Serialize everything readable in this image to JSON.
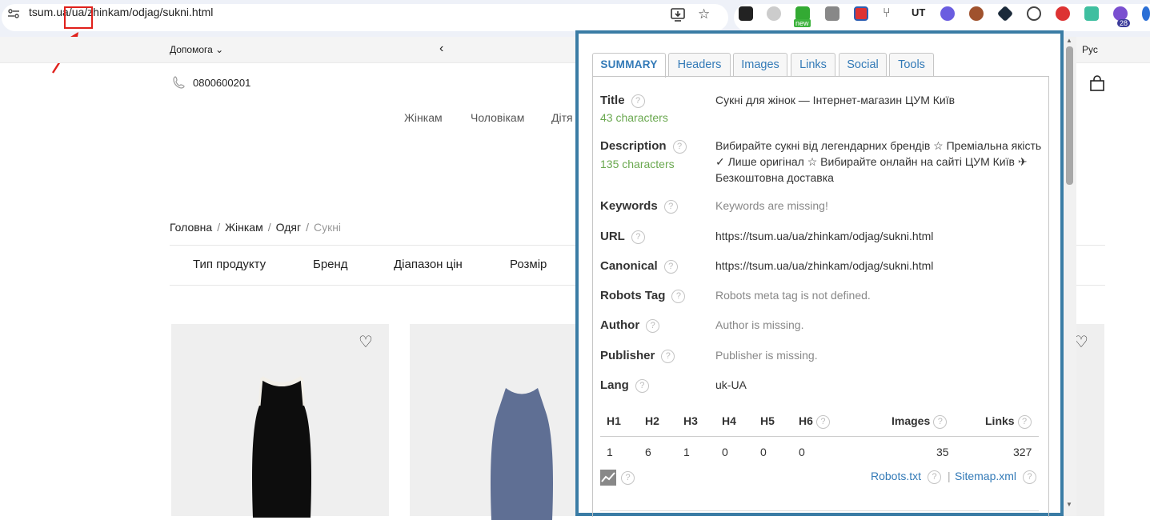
{
  "browser": {
    "url_host": "tsum.ua",
    "url_path": "/ua/zhinkam/odjag/sukni.html",
    "extension_badges": {
      "new_label": "new",
      "count_label": "28"
    }
  },
  "site": {
    "help_label": "Допомога",
    "lang_label": "Рус",
    "phone": "0800600201",
    "menu": {
      "zhinkam": "Жінкам",
      "cholovikam": "Чоловікам",
      "ditiam": "Дітя"
    },
    "breadcrumb": {
      "home": "Головна",
      "women": "Жінкам",
      "clothes": "Одяг",
      "current": "Сукні",
      "sep": "/"
    },
    "filters": {
      "type": "Тип продукту",
      "brand": "Бренд",
      "price": "Діапазон цін",
      "size": "Розмір"
    }
  },
  "seo": {
    "tabs": {
      "summary": "SUMMARY",
      "headers": "Headers",
      "images": "Images",
      "links": "Links",
      "social": "Social",
      "tools": "Tools"
    },
    "help_glyph": "?",
    "rows": {
      "title": {
        "label": "Title",
        "value": "Сукні для жінок — Інтернет-магазин ЦУМ Київ",
        "chars": "43 characters"
      },
      "description": {
        "label": "Description",
        "value": "Вибирайте сукні від легендарних брендів ☆ Преміальна якість ✓ Лише оригінал ☆ Вибирайте онлайн на сайті ЦУМ Київ ✈ Безкоштовна доставка",
        "chars": "135 characters"
      },
      "keywords": {
        "label": "Keywords",
        "value": "Keywords are missing!"
      },
      "url": {
        "label": "URL",
        "value": "https://tsum.ua/ua/zhinkam/odjag/sukni.html"
      },
      "canonical": {
        "label": "Canonical",
        "value": "https://tsum.ua/ua/zhinkam/odjag/sukni.html"
      },
      "robots": {
        "label": "Robots Tag",
        "value": "Robots meta tag is not defined."
      },
      "author": {
        "label": "Author",
        "value": "Author is missing."
      },
      "publisher": {
        "label": "Publisher",
        "value": "Publisher is missing."
      },
      "lang": {
        "label": "Lang",
        "value": "uk-UA"
      }
    },
    "stats": {
      "headers": {
        "h1": "H1",
        "h2": "H2",
        "h3": "H3",
        "h4": "H4",
        "h5": "H5",
        "h6": "H6",
        "images": "Images",
        "links": "Links"
      },
      "values": {
        "h1": "1",
        "h2": "6",
        "h3": "1",
        "h4": "0",
        "h5": "0",
        "h6": "0",
        "images": "35",
        "links": "327"
      }
    },
    "footer_links": {
      "robots": "Robots.txt",
      "sitemap": "Sitemap.xml",
      "sep": "|"
    }
  },
  "colors": {
    "panel_border": "#3a7ca5",
    "link": "#337ab7",
    "chars_green": "#6aa84f",
    "annotation_red": "#e0201b"
  }
}
